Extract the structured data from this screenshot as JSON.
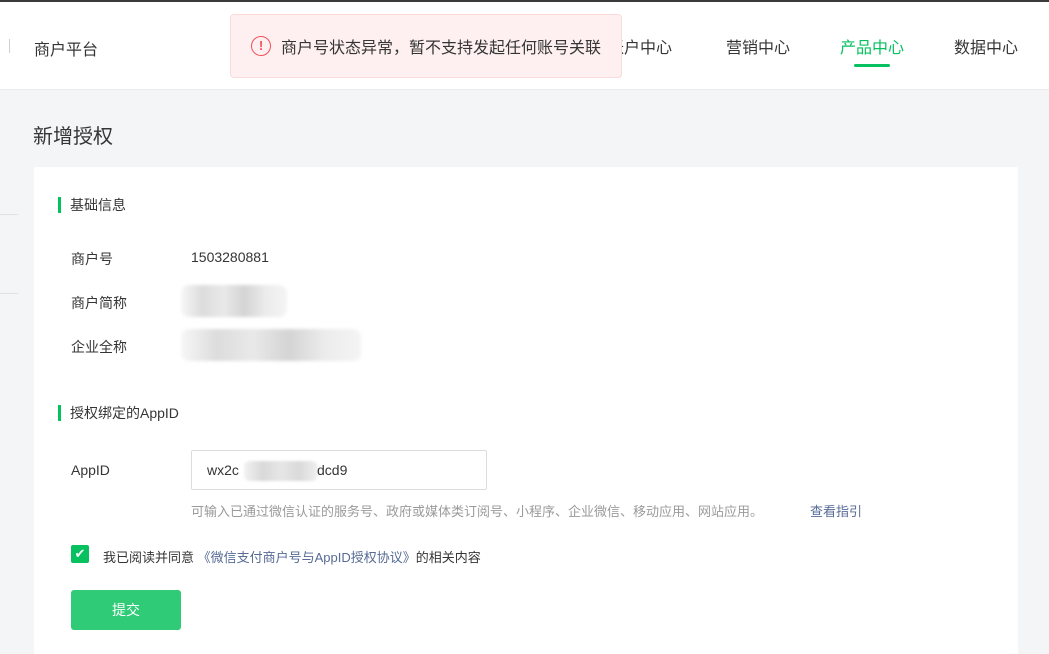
{
  "header": {
    "brand": "商户平台",
    "nav": [
      {
        "label": "账户中心",
        "active": false
      },
      {
        "label": "营销中心",
        "active": false
      },
      {
        "label": "产品中心",
        "active": true
      },
      {
        "label": "数据中心",
        "active": false
      }
    ]
  },
  "toast": {
    "icon": "exclamation-circle-icon",
    "message": "商户号状态异常，暂不支持发起任何账号关联"
  },
  "page": {
    "title": "新增授权"
  },
  "basic_info": {
    "section_title": "基础信息",
    "merchant_id_label": "商户号",
    "merchant_id_value": "1503280881",
    "short_name_label": "商户简称",
    "full_name_label": "企业全称"
  },
  "appid_section": {
    "section_title": "授权绑定的AppID",
    "appid_label": "AppID",
    "appid_visible_prefix": "wx2c",
    "appid_visible_suffix": "dcd9",
    "hint": "可输入已通过微信认证的服务号、政府或媒体类订阅号、小程序、企业微信、移动应用、网站应用。",
    "hint_link": "查看指引"
  },
  "agreement": {
    "checked": true,
    "text_before": "我已阅读并同意 ",
    "link": "《微信支付商户号与AppID授权协议》",
    "text_after": "的相关内容"
  },
  "actions": {
    "submit_label": "提交"
  },
  "colors": {
    "accent": "#07c160",
    "submit": "#2fcb76",
    "link": "#576b95",
    "error": "#f0505a"
  }
}
